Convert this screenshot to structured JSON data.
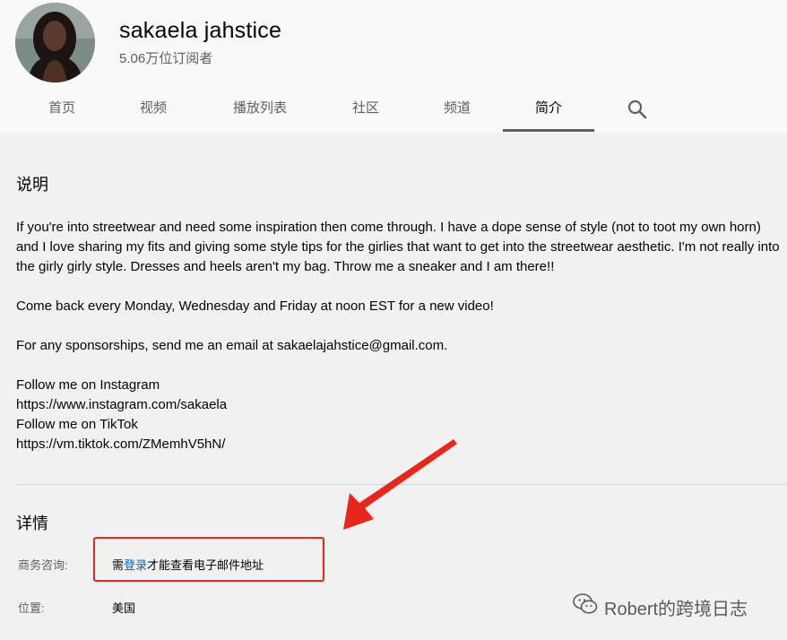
{
  "channel": {
    "name": "sakaela jahstice",
    "subscribers": "5.06万位订阅者"
  },
  "tabs": [
    "首页",
    "视频",
    "播放列表",
    "社区",
    "频道",
    "简介"
  ],
  "active_tab": "简介",
  "about": {
    "description_title": "说明",
    "description_paragraphs": [
      "If you're into streetwear and need some inspiration then come through. I have a dope sense of style (not to toot my own horn) and I love sharing my fits and giving some style tips for the girlies that want to get into the streetwear aesthetic. I'm not really into the girly girly style. Dresses and heels aren't my bag. Throw me a sneaker and I am there!!",
      "Come back every Monday, Wednesday and Friday at noon EST for a new video!",
      "For any sponsorships, send me an email at sakaelajahstice@gmail.com."
    ],
    "links_lines": [
      "Follow me on Instagram",
      "https://www.instagram.com/sakaela",
      "Follow me on TikTok",
      "https://vm.tiktok.com/ZMemhV5hN/"
    ],
    "details_title": "详情",
    "business_label": "商务咨询:",
    "business_prefix": "需",
    "business_link": "登录",
    "business_suffix": "才能查看电子邮件地址",
    "location_label": "位置:",
    "location_value": "美国"
  },
  "watermark": "Robert的跨境日志",
  "colors": {
    "annotation_red": "#e8261c",
    "link_blue": "#065fd4",
    "page_bg": "#f1f1f1",
    "header_bg": "#f9f9f9"
  },
  "icons": [
    "search-icon",
    "wechat-icon",
    "annotation-arrow"
  ]
}
